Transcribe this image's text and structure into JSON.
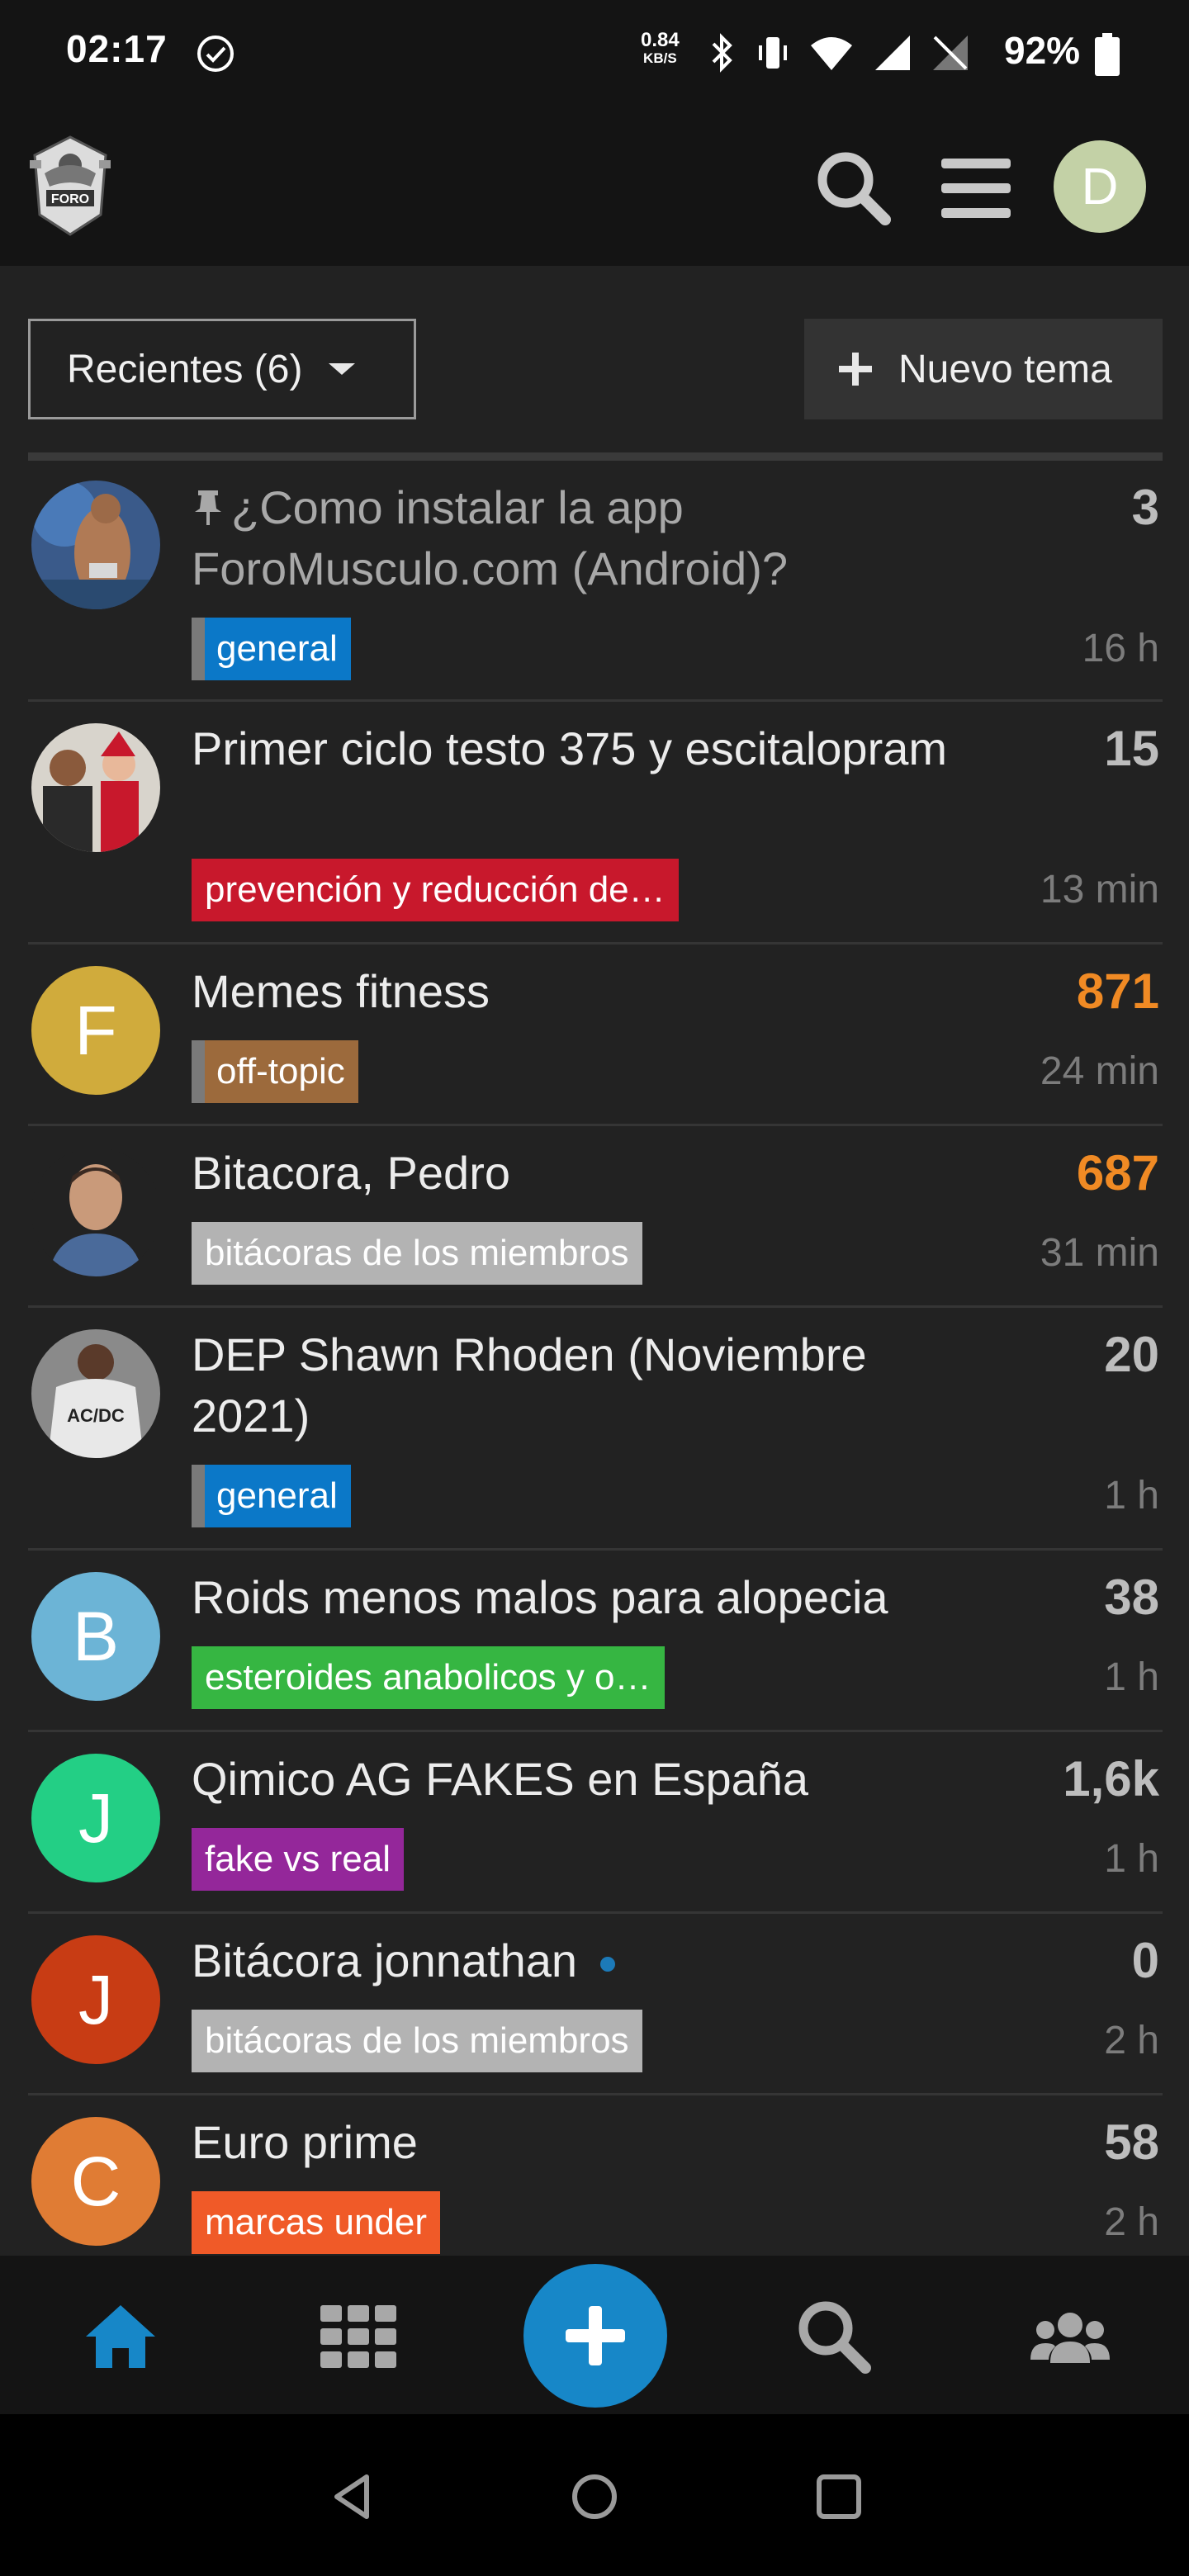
{
  "status_bar": {
    "time": "02:17",
    "speed_value": "0.84",
    "speed_unit": "KB/S",
    "battery": "92%",
    "icons": [
      "check-circle-icon",
      "bluetooth-icon",
      "vibrate-icon",
      "wifi-icon",
      "signal-icon",
      "no-sim-icon",
      "battery-icon"
    ]
  },
  "header": {
    "logo_icon": "foro-logo",
    "search_icon": "search-icon",
    "menu_icon": "hamburger-icon",
    "user_initial": "D",
    "user_color": "#c3d1a6"
  },
  "toolbar": {
    "filter_label": "Recientes (6)",
    "new_topic_label": "Nuevo tema"
  },
  "topics": [
    {
      "title": "¿Como instalar la app ForoMusculo.com (Android)?",
      "pinned": true,
      "read": true,
      "category": "general",
      "category_color": "#0b78c8",
      "count": "3",
      "time": "16 h",
      "avatar": "photo"
    },
    {
      "title": "Primer ciclo testo 375 y escitalopram",
      "category": "prevención y reducción de…",
      "category_color": "#c8182c",
      "count": "15",
      "time": "13 min",
      "avatar": "photo"
    },
    {
      "title": "Memes fitness",
      "category": "off-topic",
      "category_color": "#9c6a3c",
      "count": "871",
      "hot": true,
      "time": "24 min",
      "avatar_letter": "F",
      "avatar_color": "#d0ab3c"
    },
    {
      "title": "Bitacora, Pedro",
      "category": "bitácoras de los miembros",
      "category_color": "#b3b3b3",
      "count": "687",
      "hot": true,
      "time": "31 min",
      "avatar": "photo"
    },
    {
      "title": "DEP Shawn Rhoden (Noviembre 2021)",
      "category": "general",
      "category_color": "#0b78c8",
      "count": "20",
      "time": "1 h",
      "avatar": "photo"
    },
    {
      "title": "Roids menos malos para alopecia",
      "category": "esteroides anabolicos y o…",
      "category_color": "#36b642",
      "count": "38",
      "time": "1 h",
      "avatar_letter": "B",
      "avatar_color": "#6cb4d6"
    },
    {
      "title": "Qimico AG FAKES en España",
      "category": "fake vs real",
      "category_color": "#94279a",
      "count": "1,6k",
      "time": "1 h",
      "avatar_letter": "J",
      "avatar_color": "#23cf85"
    },
    {
      "title": "Bitácora jonnathan",
      "unread": true,
      "category": "bitácoras de los miembros",
      "category_color": "#b3b3b3",
      "count": "0",
      "time": "2 h",
      "avatar_letter": "J",
      "avatar_color": "#c83c14"
    },
    {
      "title": "Euro prime",
      "category": "marcas under",
      "category_color": "#f05a28",
      "count": "58",
      "time": "2 h",
      "avatar_letter": "C",
      "avatar_color": "#e07c34"
    }
  ],
  "bottom_nav": {
    "items": [
      "home-icon",
      "categories-grid-icon",
      "new-topic-plus-icon",
      "search-icon",
      "users-icon"
    ],
    "active": "home-icon",
    "accent_color": "#1787c8"
  },
  "android_nav": [
    "back-icon",
    "home-circle-icon",
    "recents-icon"
  ]
}
